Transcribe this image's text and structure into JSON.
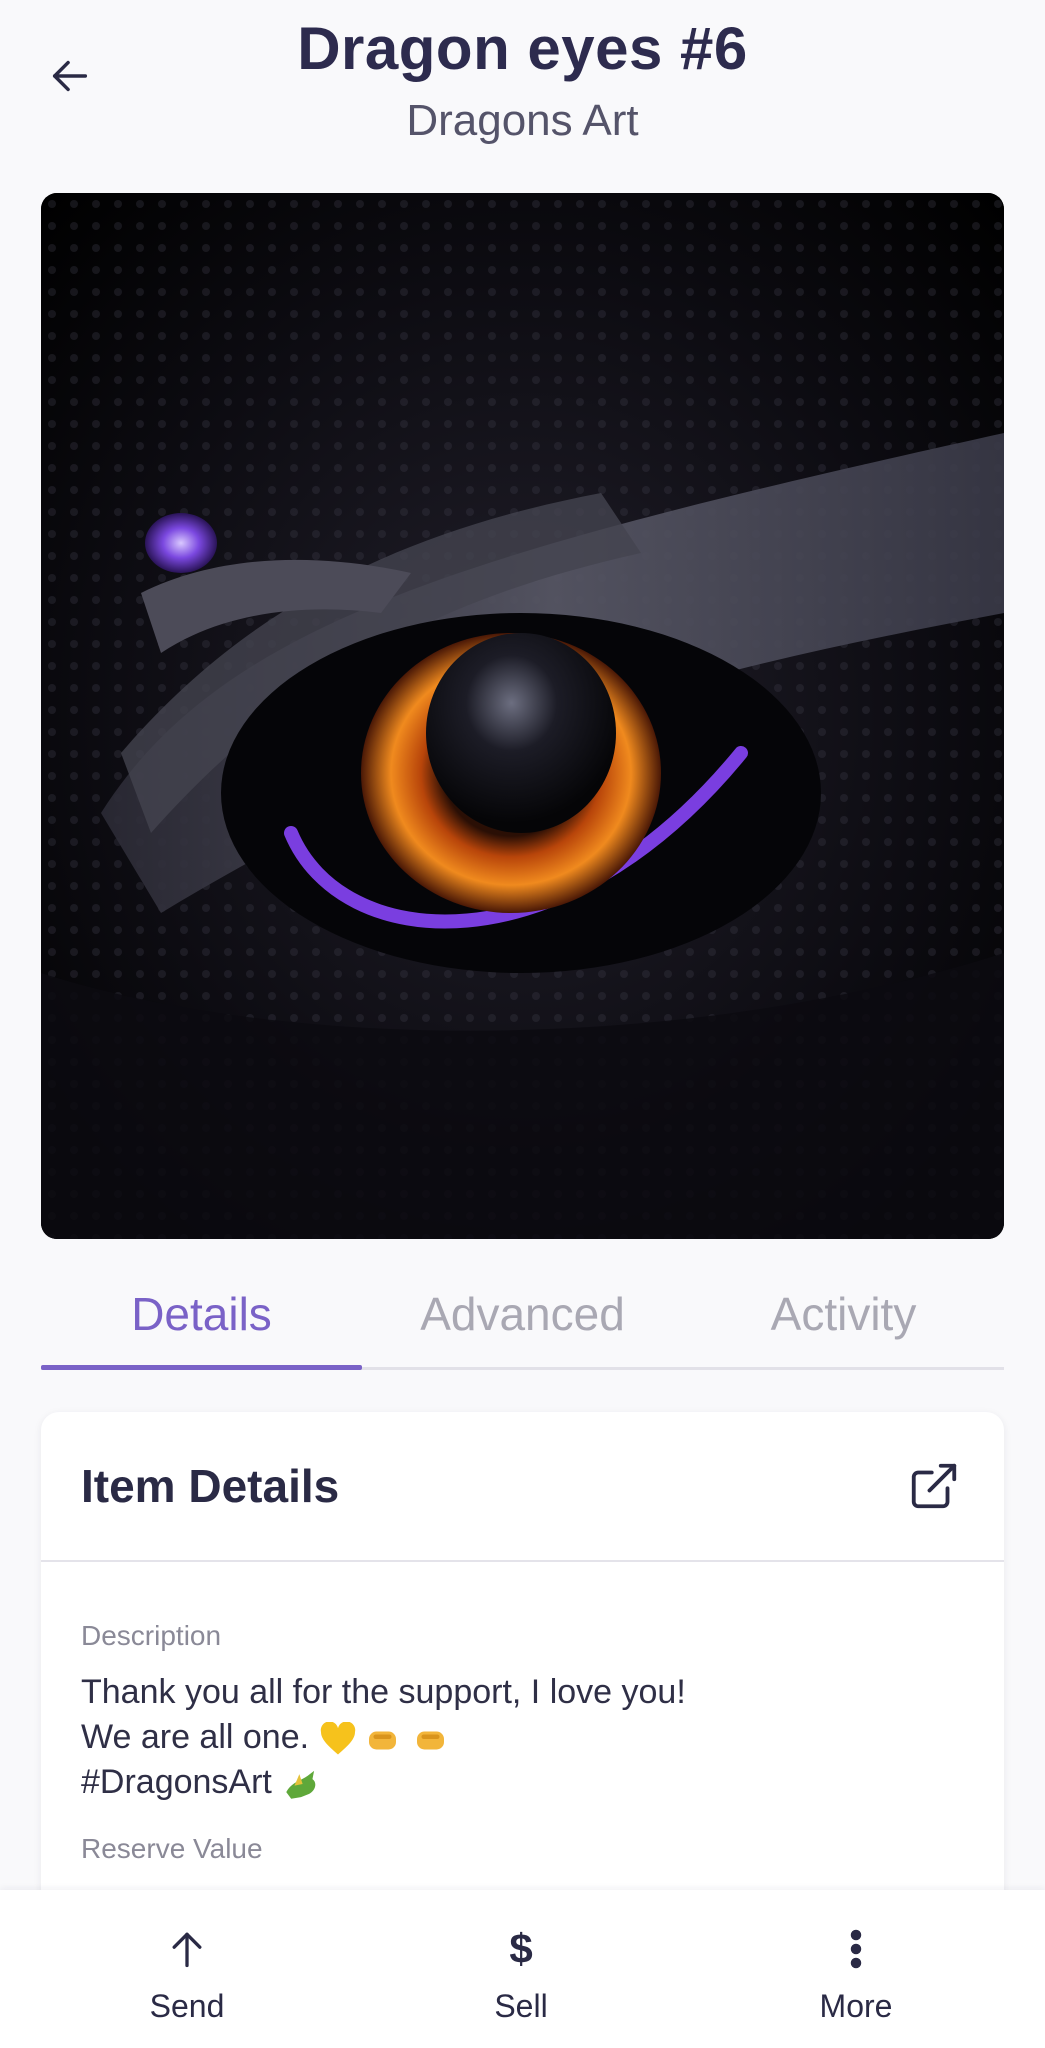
{
  "header": {
    "title": "Dragon eyes #6",
    "subtitle": "Dragons Art",
    "back_icon": "arrow-left-icon"
  },
  "tabs": [
    {
      "label": "Details",
      "active": true
    },
    {
      "label": "Advanced",
      "active": false
    },
    {
      "label": "Activity",
      "active": false
    }
  ],
  "card": {
    "title": "Item Details",
    "external_icon": "external-link-icon",
    "description_label": "Description",
    "description_lines": [
      "Thank you all for the support, I love you!",
      "We are all one.",
      "#DragonsArt"
    ],
    "reserve_label": "Reserve Value"
  },
  "bottom_nav": {
    "send": {
      "label": "Send",
      "icon": "arrow-up-icon"
    },
    "sell": {
      "label": "Sell",
      "icon": "$"
    },
    "more": {
      "label": "More",
      "icon": "more-vertical-icon"
    }
  },
  "colors": {
    "accent": "#7a62c7",
    "text": "#2a2a45",
    "muted": "#a9a8b3",
    "background": "#f9f9fb"
  }
}
